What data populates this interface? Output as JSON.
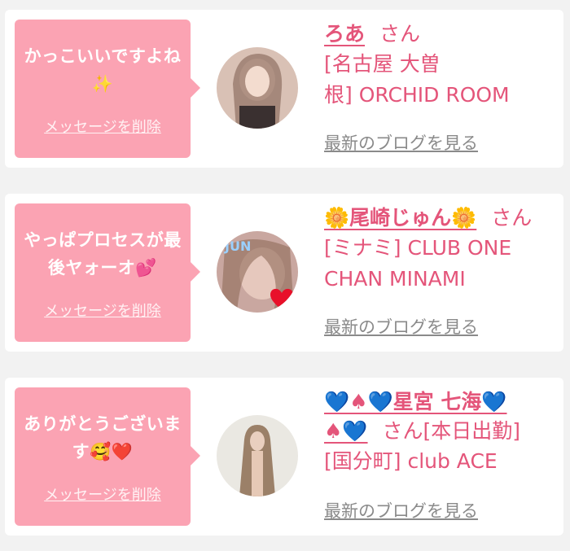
{
  "items": [
    {
      "message": "かっこいいですよね✨",
      "delete_label": "メッセージを削除",
      "name": "ろあ",
      "suffix": "さん",
      "shop_line1": "[名古屋 大曽",
      "shop_line2": "根] ORCHID ROOM",
      "blog_label": "最新のブログを見る",
      "avatar_icon": "user-photo-icon"
    },
    {
      "message": "やっぱプロセスが最後ヤォーオ💕",
      "delete_label": "メッセージを削除",
      "name": "🌼尾崎じゅん🌼",
      "suffix": "さん",
      "shop_line1": "[ミナミ] CLUB ONE",
      "shop_line2": "CHAN MINAMI",
      "blog_label": "最新のブログを見る",
      "avatar_icon": "user-photo-icon",
      "avatar_overlay_text": "JUN"
    },
    {
      "message": "ありがとうございます🥰❤️",
      "delete_label": "メッセージを削除",
      "name": "💙♠💙星宮 七海💙",
      "name_cont": "♠💙",
      "suffix": "さん[本日出勤]",
      "shop_line1": "[国分町] club ACE",
      "blog_label": "最新のブログを見る",
      "avatar_icon": "user-photo-icon"
    }
  ],
  "colors": {
    "bubble": "#fba3b3",
    "accent": "#e4557a",
    "muted": "#8a8a8a",
    "background": "#f2f2f2"
  }
}
